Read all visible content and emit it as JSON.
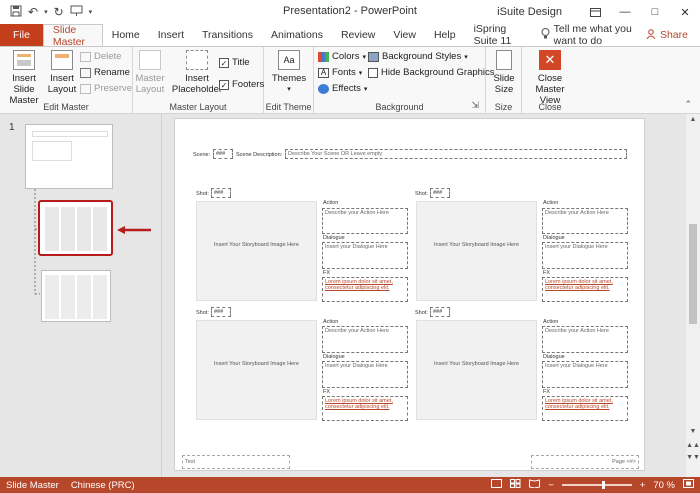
{
  "window": {
    "title": "Presentation2  -  PowerPoint",
    "user": "iSuite Design"
  },
  "tabs": [
    {
      "label": "File"
    },
    {
      "label": "Slide Master"
    },
    {
      "label": "Home"
    },
    {
      "label": "Insert"
    },
    {
      "label": "Transitions"
    },
    {
      "label": "Animations"
    },
    {
      "label": "Review"
    },
    {
      "label": "View"
    },
    {
      "label": "Help"
    },
    {
      "label": "iSpring Suite 11"
    }
  ],
  "tell_me": "Tell me what you want to do",
  "share": "Share",
  "ribbon": {
    "edit_master": {
      "label": "Edit Master",
      "insert_slide_master": "Insert Slide\nMaster",
      "insert_layout": "Insert\nLayout",
      "delete": "Delete",
      "rename": "Rename",
      "preserve": "Preserve"
    },
    "master_layout": {
      "label": "Master Layout",
      "master_layout": "Master\nLayout",
      "insert_placeholder": "Insert\nPlaceholder",
      "title": "Title",
      "footers": "Footers"
    },
    "edit_theme": {
      "label": "Edit Theme",
      "themes": "Themes"
    },
    "background": {
      "label": "Background",
      "colors": "Colors",
      "fonts": "Fonts",
      "effects": "Effects",
      "background_styles": "Background Styles",
      "hide_background_graphics": "Hide Background Graphics"
    },
    "size": {
      "label": "Size",
      "slide_size": "Slide\nSize"
    },
    "close": {
      "label": "Close",
      "close_master_view": "Close\nMaster View"
    }
  },
  "thumbnails": {
    "master_number": "1"
  },
  "slide": {
    "scene_label": "Scene:",
    "scene_value": "###",
    "scene_desc_label": "Scene Description:",
    "scene_desc_value": "Describe Your Scene OR Leave empty",
    "shot_label": "Shot:",
    "shot_value": "###",
    "storyboard_text": "Insert Your Storyboard Image Here",
    "action_label": "Action",
    "action_value": "Describe your Action Here",
    "dialogue_label": "Dialogue",
    "dialogue_value": "Insert your Dialogue Here",
    "fx_label": "FX",
    "fx_value_1": "Lorem ipsum dolor sit amet,",
    "fx_value_2": "consectetur adipiscing elit.",
    "footer_left": "Text",
    "footer_right": "Page <#>"
  },
  "status": {
    "view": "Slide Master",
    "language": "Chinese (PRC)",
    "zoom": "70 %",
    "zoom_fraction": 0.6
  },
  "colors": {
    "accent": "#b7472a",
    "file_tab": "#c43e1c"
  }
}
